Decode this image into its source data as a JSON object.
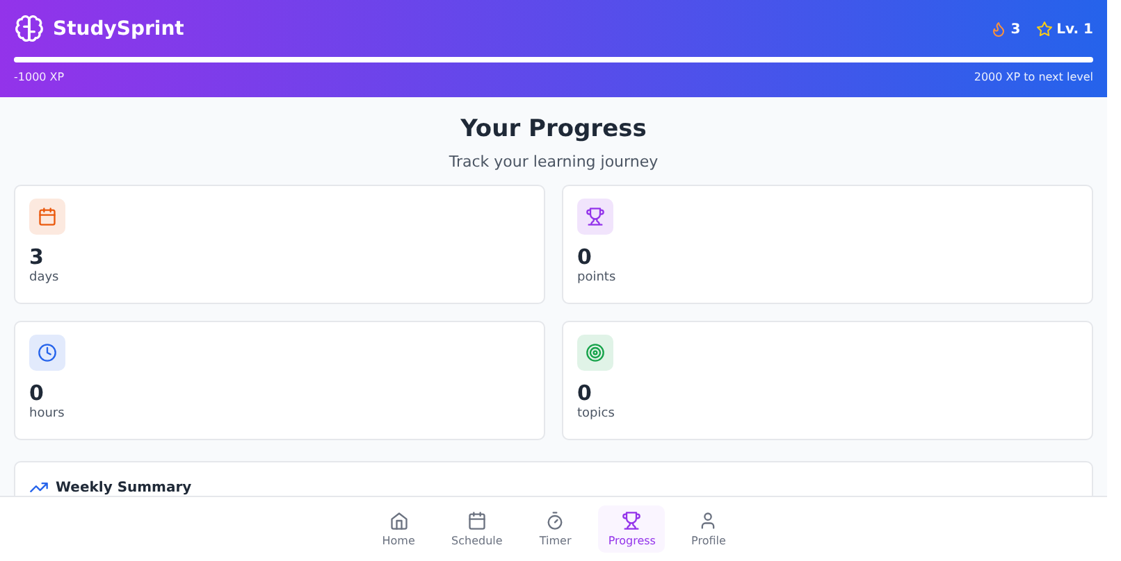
{
  "header": {
    "app_name": "StudySprint",
    "streak": "3",
    "level_label": "Lv. 1",
    "xp": {
      "level": 1,
      "current": "-1000 XP",
      "next": "2000 XP to next level"
    }
  },
  "page": {
    "title": "Your Progress",
    "subtitle": "Track your learning journey"
  },
  "stats": [
    {
      "kind": "calendar",
      "color": "#ea580c",
      "value": "3",
      "unit": "days"
    },
    {
      "kind": "trophy",
      "color": "#9333ea",
      "value": "0",
      "unit": "points"
    },
    {
      "kind": "clock",
      "color": "#2563eb",
      "value": "0",
      "unit": "hours"
    },
    {
      "kind": "target",
      "color": "#16a34a",
      "value": "0",
      "unit": "topics"
    }
  ],
  "weekly_summary": {
    "title": "Weekly Summary"
  },
  "nav": [
    {
      "kind": "home",
      "label": "Home",
      "selected": false
    },
    {
      "kind": "calendar",
      "label": "Schedule",
      "selected": false
    },
    {
      "kind": "timer",
      "label": "Timer",
      "selected": false
    },
    {
      "kind": "trophy",
      "label": "Progress",
      "selected": true
    },
    {
      "kind": "user",
      "label": "Profile",
      "selected": false
    }
  ]
}
